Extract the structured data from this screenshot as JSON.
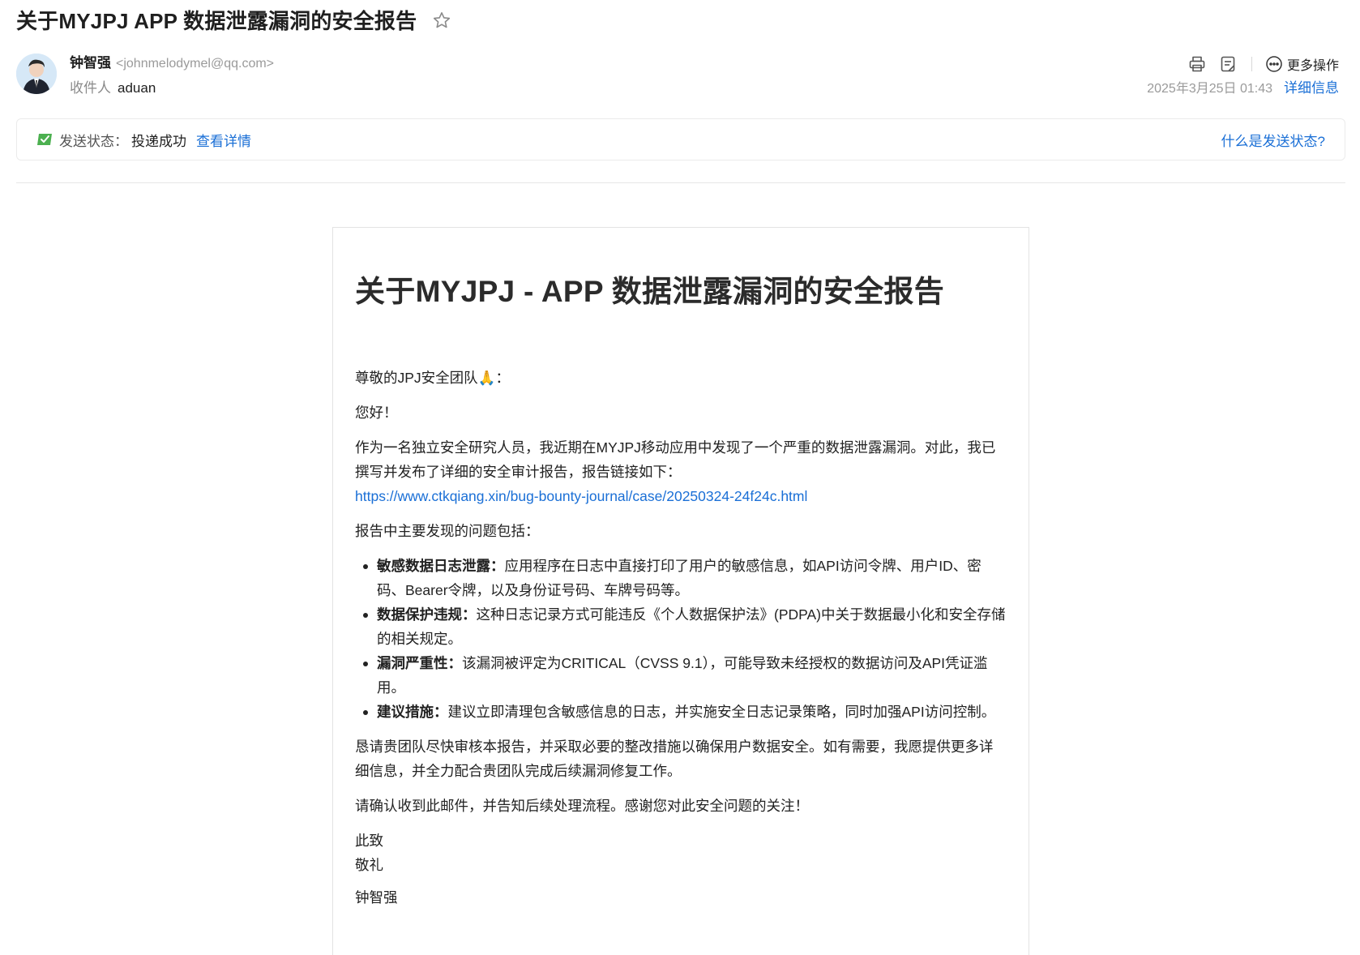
{
  "subject": "关于MYJPJ APP 数据泄露漏洞的安全报告",
  "sender": {
    "name": "钟智强",
    "email": "<johnmelodymel@qq.com>"
  },
  "recipient": {
    "label": "收件人",
    "value": "aduan"
  },
  "toolbar": {
    "print_icon": "printer-icon",
    "note_icon": "note-icon",
    "more_label": "更多操作"
  },
  "meta": {
    "date": "2025年3月25日 01:43",
    "details_label": "详细信息"
  },
  "status": {
    "label": "发送状态：",
    "value": "投递成功",
    "detail_link": "查看详情",
    "help_link": "什么是发送状态?"
  },
  "body": {
    "title": "关于MYJPJ - APP 数据泄露漏洞的安全报告",
    "greeting": "尊敬的JPJ安全团队🙏：",
    "hello": "您好！",
    "intro": "作为一名独立安全研究人员，我近期在MYJPJ移动应用中发现了一个严重的数据泄露漏洞。对此，我已撰写并发布了详细的安全审计报告，报告链接如下：",
    "report_link": "https://www.ctkqiang.xin/bug-bounty-journal/case/20250324-24f24c.html",
    "issues_intro": "报告中主要发现的问题包括：",
    "bullets": [
      {
        "head": "敏感数据日志泄露：",
        "text": "应用程序在日志中直接打印了用户的敏感信息，如API访问令牌、用户ID、密码、Bearer令牌，以及身份证号码、车牌号码等。"
      },
      {
        "head": "数据保护违规：",
        "text": "这种日志记录方式可能违反《个人数据保护法》(PDPA)中关于数据最小化和安全存储的相关规定。"
      },
      {
        "head": "漏洞严重性：",
        "text": "该漏洞被评定为CRITICAL（CVSS 9.1），可能导致未经授权的数据访问及API凭证滥用。"
      },
      {
        "head": "建议措施：",
        "text": "建议立即清理包含敏感信息的日志，并实施安全日志记录策略，同时加强API访问控制。"
      }
    ],
    "request": "恳请贵团队尽快审核本报告，并采取必要的整改措施以确保用户数据安全。如有需要，我愿提供更多详细信息，并全力配合贵团队完成后续漏洞修复工作。",
    "confirm": "请确认收到此邮件，并告知后续处理流程。感谢您对此安全问题的关注！",
    "closing_1": "此致",
    "closing_2": "敬礼",
    "signature": "钟智强"
  }
}
